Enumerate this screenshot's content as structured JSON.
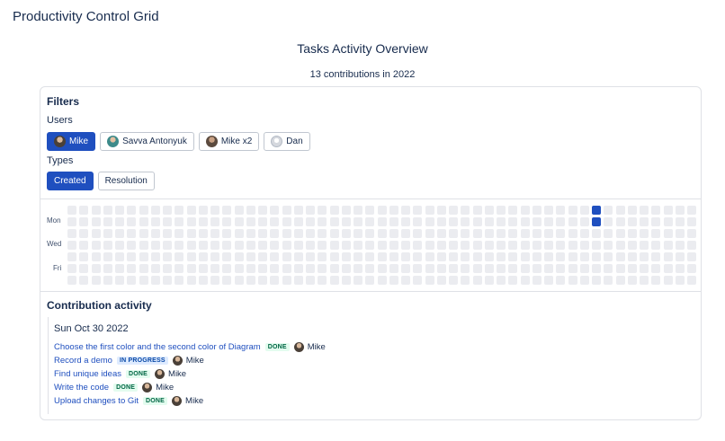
{
  "app": {
    "title": "Productivity Control Grid"
  },
  "overview": {
    "title": "Tasks Activity Overview",
    "count_text": "13 contributions in 2022"
  },
  "filters": {
    "title": "Filters",
    "users_label": "Users",
    "users": [
      {
        "name": "Mike",
        "active": true,
        "avatar": "mike"
      },
      {
        "name": "Savva Antonyuk",
        "active": false,
        "avatar": "savva"
      },
      {
        "name": "Mike x2",
        "active": false,
        "avatar": "mike2"
      },
      {
        "name": "Dan",
        "active": false,
        "avatar": "dan"
      }
    ],
    "types_label": "Types",
    "types": [
      {
        "name": "Created",
        "active": true
      },
      {
        "name": "Resolution",
        "active": false
      }
    ]
  },
  "heatmap": {
    "day_labels": [
      "Mon",
      "Wed",
      "Fri"
    ],
    "weeks": 53,
    "active_cells": [
      {
        "week": 44,
        "day": 0
      },
      {
        "week": 44,
        "day": 1
      }
    ],
    "colors": {
      "empty": "#ebecf0",
      "active": "#1f4fbf"
    }
  },
  "activity": {
    "title": "Contribution activity",
    "date": "Sun Oct 30 2022",
    "tasks": [
      {
        "title": "Choose the first color and the second color of Diagram",
        "status": "DONE",
        "assignee": "Mike"
      },
      {
        "title": "Record a demo",
        "status": "IN PROGRESS",
        "assignee": "Mike"
      },
      {
        "title": "Find unique ideas",
        "status": "DONE",
        "assignee": "Mike"
      },
      {
        "title": "Write the code",
        "status": "DONE",
        "assignee": "Mike"
      },
      {
        "title": "Upload changes to Git",
        "status": "DONE",
        "assignee": "Mike"
      }
    ]
  }
}
